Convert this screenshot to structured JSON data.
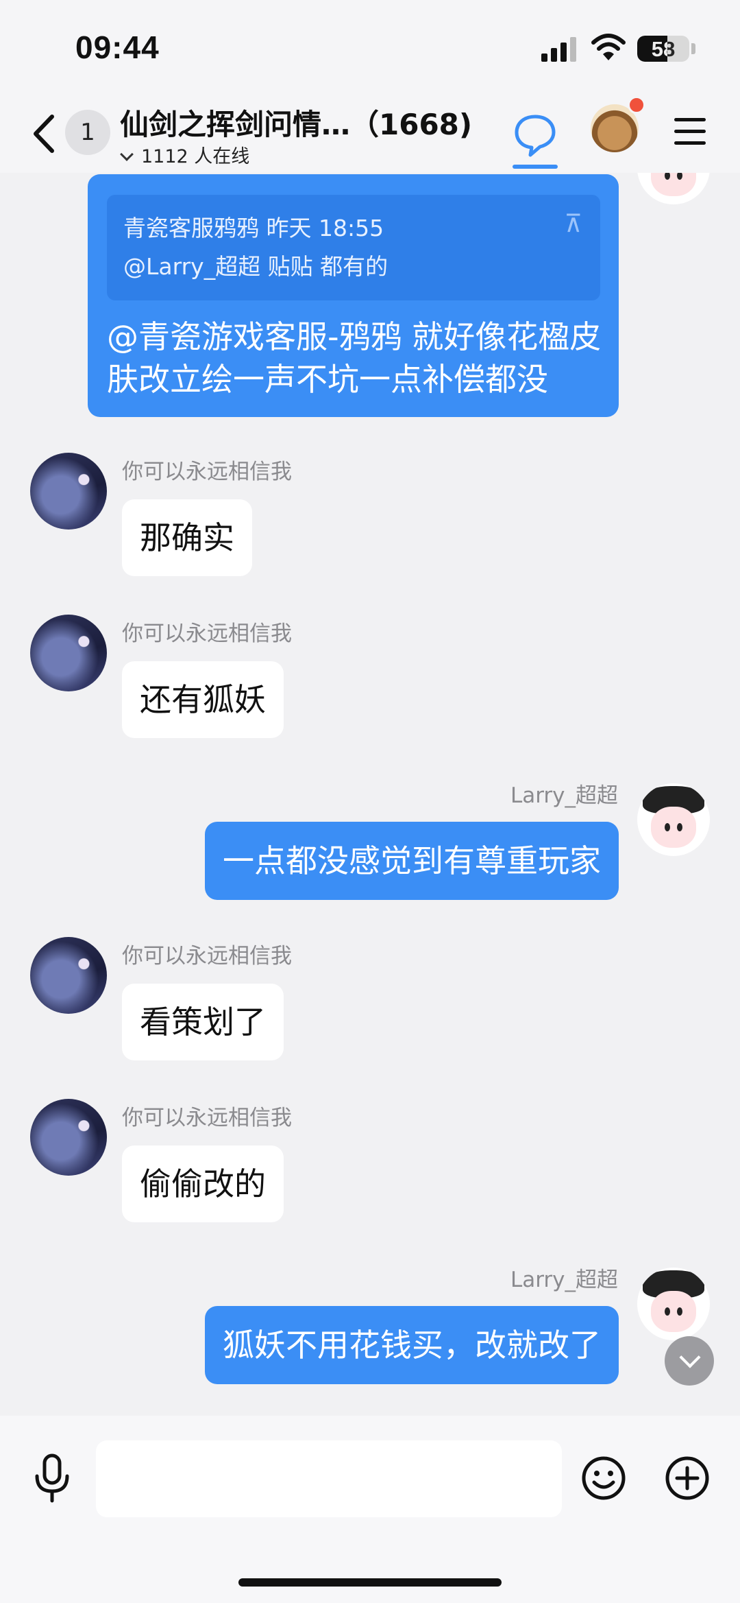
{
  "status_bar": {
    "time": "09:44",
    "battery": "58",
    "battery_level": 0.58
  },
  "header": {
    "unread_count": "1",
    "title": "仙剑之挥剑问情…（1668)",
    "online_text": "1112 人在线",
    "icons": [
      "back-icon",
      "chat-bubble-icon",
      "avatar",
      "menu-icon"
    ],
    "accent_color": "#3b8ef5",
    "notification_color": "#f0513b"
  },
  "messages": {
    "quoted": {
      "quote_line1": "青瓷客服鸦鸦 昨天 18:55",
      "quote_line2": "@Larry_超超 贴贴 都有的",
      "text": "@青瓷游戏客服-鸦鸦 就好像花楹皮肤改立绘一声不坑一点补偿都没"
    },
    "items": [
      {
        "sender": "你可以永远相信我",
        "text": "那确实"
      },
      {
        "sender": "你可以永远相信我",
        "text": "还有狐妖"
      },
      {
        "sender": "Larry_超超",
        "text": "一点都没感觉到有尊重玩家"
      },
      {
        "sender": "你可以永远相信我",
        "text": "看策划了"
      },
      {
        "sender": "你可以永远相信我",
        "text": "偷偷改的"
      },
      {
        "sender": "Larry_超超",
        "text": "狐妖不用花钱买，改就改了"
      }
    ]
  },
  "input_bar": {
    "value": "",
    "icons": [
      "microphone-icon",
      "emoji-icon",
      "plus-icon"
    ]
  }
}
